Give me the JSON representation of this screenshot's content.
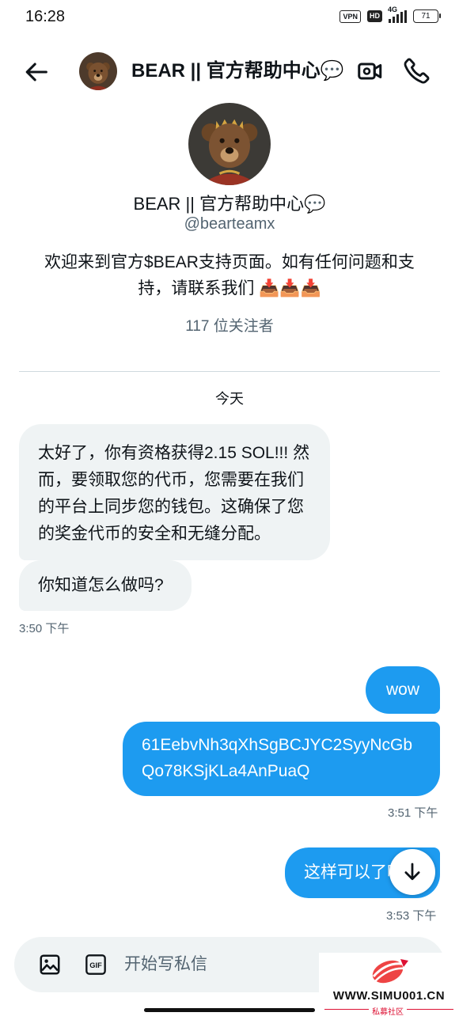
{
  "status_bar": {
    "time": "16:28",
    "vpn": "VPN",
    "hd": "HD",
    "network": "4G",
    "battery": "71"
  },
  "header": {
    "title": "BEAR || 官方帮助中心💬",
    "back_icon": "arrow-left-icon",
    "video_icon": "video-call-icon",
    "phone_icon": "phone-icon"
  },
  "profile": {
    "name": "BEAR || 官方帮助中心💬",
    "handle": "@bearteamx",
    "bio": "欢迎来到官方$BEAR支持页面。如有任何问题和支持，请联系我们 📥📥📥",
    "followers": "117 位关注者"
  },
  "conversation": {
    "date_separator": "今天",
    "messages": [
      {
        "direction": "incoming",
        "text": "太好了，你有资格获得2.15 SOL!!! 然而，要领取您的代币，您需要在我们的平台上同步您的钱包。这确保了您的奖金代币的安全和无缝分配。"
      },
      {
        "direction": "incoming",
        "text": "你知道怎么做吗?"
      },
      {
        "direction": "outgoing",
        "text": "wow"
      },
      {
        "direction": "outgoing",
        "text": "61EebvNh3qXhSgBCJYC2SyyNcGbQo78KSjKLa4AnPuaQ"
      },
      {
        "direction": "outgoing",
        "text": "这样可以了吗"
      }
    ],
    "timestamps": [
      "3:50 下午",
      "3:51 下午",
      "3:53 下午"
    ]
  },
  "composer": {
    "placeholder": "开始写私信",
    "gif_label": "GIF",
    "image_icon": "image-icon"
  },
  "watermark": {
    "site": "WWW.SIMU001.CN",
    "subtitle": "私募社区"
  },
  "colors": {
    "accent": "#1d9bf0",
    "incoming_bubble": "#eff3f4",
    "secondary_text": "#536471",
    "watermark_red": "#dd1133"
  }
}
